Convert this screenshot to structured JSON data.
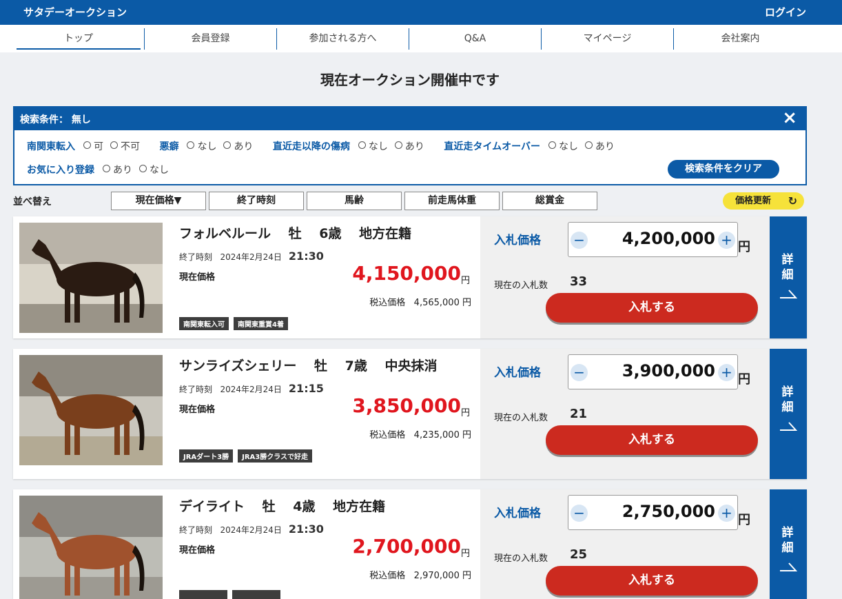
{
  "header": {
    "brand": "サタデーオークション",
    "login": "ログイン"
  },
  "nav": [
    "トップ",
    "会員登録",
    "参加される方へ",
    "Q&A",
    "マイページ",
    "会社案内"
  ],
  "heading": "現在オークション開催中です",
  "filter": {
    "title": "検索条件： 無し",
    "close_icon": "×",
    "groups": [
      {
        "label": "南関東転入",
        "options": [
          "可",
          "不可"
        ]
      },
      {
        "label": "悪癖",
        "options": [
          "なし",
          "あり"
        ]
      },
      {
        "label": "直近走以降の傷病",
        "options": [
          "なし",
          "あり"
        ]
      },
      {
        "label": "直近走タイムオーバー",
        "options": [
          "なし",
          "あり"
        ]
      },
      {
        "label": "お気に入り登録",
        "options": [
          "あり",
          "なし"
        ]
      }
    ],
    "clear_label": "検索条件をクリア"
  },
  "sort": {
    "label": "並べ替え",
    "buttons": [
      "現在価格▼",
      "終了時刻",
      "馬齢",
      "前走馬体重",
      "総賞金"
    ],
    "refresh_label": "価格更新",
    "refresh_icon": "↻"
  },
  "labels": {
    "end_time": "終了時刻",
    "current_price": "現在価格",
    "tax_price": "税込価格",
    "yen": "円",
    "bid_price": "入札価格",
    "bid_count": "現在の入札数",
    "bid_button": "入札する",
    "detail": "詳細",
    "detail_arrow": "↗"
  },
  "listings": [
    {
      "title": "フォルベルール　 牡　 6歳　 地方在籍",
      "end_date": "2024年2月24日",
      "end_time": "21:30",
      "current_price": "4,150,000",
      "tax_price": "4,565,000",
      "tags": [
        "南関東転入可",
        "南関東重賞4着"
      ],
      "bid_amount": "4,200,000",
      "bid_count": "33",
      "coat": "dark-bay"
    },
    {
      "title": "サンライズシェリー　 牡　 7歳　 中央抹消",
      "end_date": "2024年2月24日",
      "end_time": "21:15",
      "current_price": "3,850,000",
      "tax_price": "4,235,000",
      "tags": [
        "JRAダート3勝",
        "JRA3勝クラスで好走"
      ],
      "bid_amount": "3,900,000",
      "bid_count": "21",
      "coat": "bay"
    },
    {
      "title": "デイライト　 牡　 4歳　 地方在籍",
      "end_date": "2024年2月24日",
      "end_time": "21:30",
      "current_price": "2,700,000",
      "tax_price": "2,970,000",
      "tags": [
        "",
        ""
      ],
      "bid_amount": "2,750,000",
      "bid_count": "25",
      "coat": "chestnut"
    }
  ],
  "colors": {
    "brand": "#0b5aa6",
    "price": "#e0161e",
    "bid_button": "#cc2a1f",
    "refresh": "#f6e23a"
  }
}
